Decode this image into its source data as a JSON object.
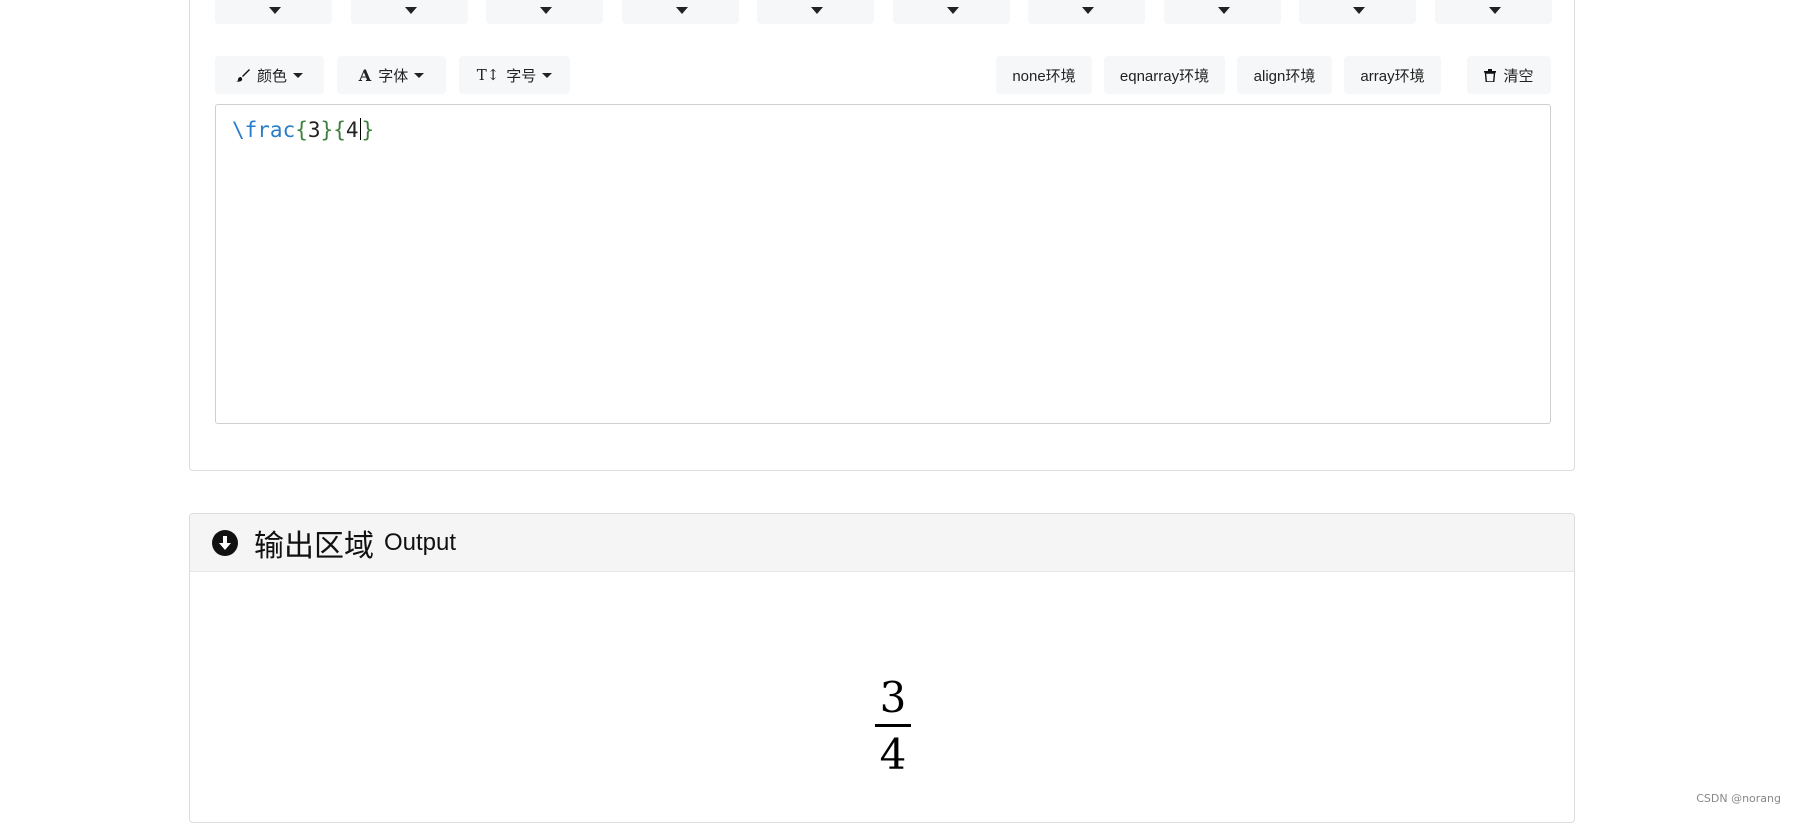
{
  "toolbar": {
    "color_label": "颜色",
    "font_label": "字体",
    "size_label": "字号",
    "size_icon_text": "T↕",
    "font_icon_text": "A",
    "env_none": "none环境",
    "env_eqnarray": "eqnarray环境",
    "env_align": "align环境",
    "env_array": "array环境",
    "clear_label": "清空",
    "icons": {
      "color": "paintbrush-icon",
      "font": "font-icon",
      "size": "text-height-icon",
      "clear": "trash-icon",
      "dropdown": "caret-down-icon"
    }
  },
  "editor": {
    "tokens": {
      "cmd": "\\frac",
      "open1": "{",
      "num1": "3",
      "close1": "}",
      "open2": "{",
      "num2": "4",
      "close2": "}"
    }
  },
  "output": {
    "title": "输出区域",
    "subtitle": "Output",
    "icon": "arrow-circle-down-icon",
    "numerator": "3",
    "denominator": "4"
  },
  "watermark": "CSDN @norang",
  "colors": {
    "latex_command": "#2a7ec9",
    "latex_brace": "#3f7f3f",
    "button_bg": "#f6f7f8",
    "header_bg": "#f5f5f5"
  }
}
